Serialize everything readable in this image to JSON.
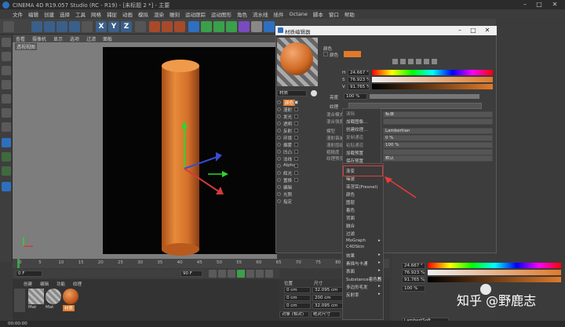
{
  "app": {
    "title": "CINEMA 4D R19.057 Studio (RC - R19) - [未标题 2 *] - 主要"
  },
  "menubar": [
    "文件",
    "编辑",
    "创建",
    "选择",
    "工具",
    "网格",
    "捕捉",
    "动画",
    "模拟",
    "渲染",
    "雕刻",
    "运动跟踪",
    "运动图形",
    "角色",
    "流水线",
    "插件",
    "Octane",
    "脚本",
    "窗口",
    "帮助"
  ],
  "viewport": {
    "menu": [
      "查看",
      "摄像机",
      "显示",
      "选项",
      "过滤",
      "面板"
    ],
    "label": "透视视图"
  },
  "dialog": {
    "title": "材质编辑器",
    "material_name": "材质",
    "channels": [
      "颜色",
      "漫射",
      "发光",
      "透明",
      "反射",
      "环境",
      "烟雾",
      "凹凸",
      "法线",
      "Alpha",
      "辉光",
      "置换",
      "编辑",
      "光照",
      "指定"
    ],
    "color_label": "颜色",
    "h_label": "H",
    "h_value": "24.667 °",
    "s_label": "S",
    "s_value": "76.923 %",
    "v_label": "V",
    "v_value": "91.765 %",
    "brightness_label": "亮度",
    "brightness_value": "100 %",
    "texture_label": "纹理",
    "props": [
      "混合模式",
      "混合强度",
      "模型",
      "漫射衰减",
      "漫射层级",
      "粗糙度",
      "纹理预览尺寸"
    ],
    "prop_values": [
      "标准",
      "",
      "Lambertian",
      "0 %",
      "100 %",
      "",
      "默认"
    ],
    "load_image": "加载图像...",
    "create_texture": "创建纹理...",
    "clear": "清除",
    "copy_channel": "复制通道",
    "paste_channel": "粘贴通道",
    "load_preset": "加载预置",
    "save_preset": "保存预置"
  },
  "context_menu": {
    "items": [
      "渐变",
      "噪波",
      "菲涅耳(Fresnel)",
      "颜色",
      "图层",
      "着色",
      "背面",
      "融合",
      "过滤",
      "MoGraph",
      "效果",
      "素描与卡通",
      "表面",
      "Substance着色器",
      "多边形毛发",
      "反射率"
    ],
    "extra": [
      "C4DSkin",
      "SubStance",
      "过滤器"
    ]
  },
  "timeline": {
    "ticks": [
      "0",
      "5",
      "10",
      "15",
      "20",
      "25",
      "30",
      "35",
      "40",
      "45",
      "50",
      "55",
      "60",
      "65",
      "70",
      "75",
      "80",
      "85",
      "90"
    ],
    "start": "0 F",
    "end": "90 F",
    "current": "0 F"
  },
  "materials": {
    "menu": [
      "创建",
      "编辑",
      "功能",
      "纹理"
    ],
    "mat1": "Mat",
    "mat2": "Mat",
    "mat3": "材质"
  },
  "coords": {
    "headers": [
      "位置",
      "尺寸",
      "旋转"
    ],
    "x": "0 cm",
    "y": "0 cm",
    "z": "0 cm",
    "sx": "32.095 cm",
    "sy": "200 cm",
    "sz": "32.095 cm",
    "h": "0 °",
    "p": "0 °",
    "b": "0 °",
    "mode": "对象 (相对)",
    "size_mode": "绝对尺寸",
    "apply": "应用"
  },
  "right_panel": {
    "h_value": "24.667 °",
    "s_value": "76.923 %",
    "v_value": "91.765 %",
    "brightness": "100 %",
    "blend_mode": "LambertSoft"
  },
  "watermark": "知乎 @野鹿志",
  "statusbar": {
    "time": "00:00:00"
  },
  "colors": {
    "accent": "#e07a2a",
    "bg": "#3a3a3a",
    "red_box": "#e83a3a"
  }
}
